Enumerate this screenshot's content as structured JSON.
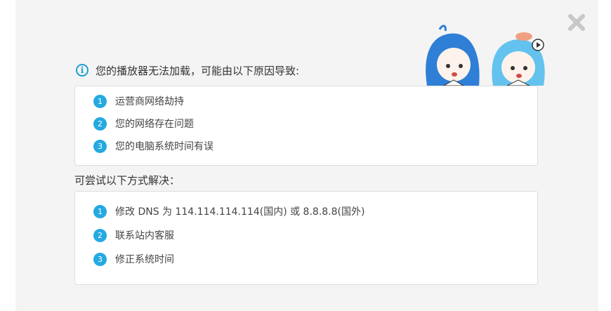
{
  "error": {
    "title": "您的播放器无法加载，可能由以下原因导致:",
    "reasons": [
      {
        "num": "1",
        "text": "运营商网络劫持"
      },
      {
        "num": "2",
        "text": "您的网络存在问题"
      },
      {
        "num": "3",
        "text": "您的电脑系统时间有误"
      }
    ]
  },
  "solutions": {
    "title": "可尝试以下方式解决：",
    "items": [
      {
        "num": "1",
        "text": "修改 DNS 为 114.114.114.114(国内) 或 8.8.8.8(国外)"
      },
      {
        "num": "2",
        "text": "联系站内客服"
      },
      {
        "num": "3",
        "text": "修正系统时间"
      }
    ]
  },
  "icons": {
    "close": "close-icon",
    "info": "info-icon",
    "mascot": "mascot-illustration"
  },
  "colors": {
    "accent": "#25a9e0",
    "panel_bg": "#f4f4f4",
    "close": "#c8c8c8"
  }
}
